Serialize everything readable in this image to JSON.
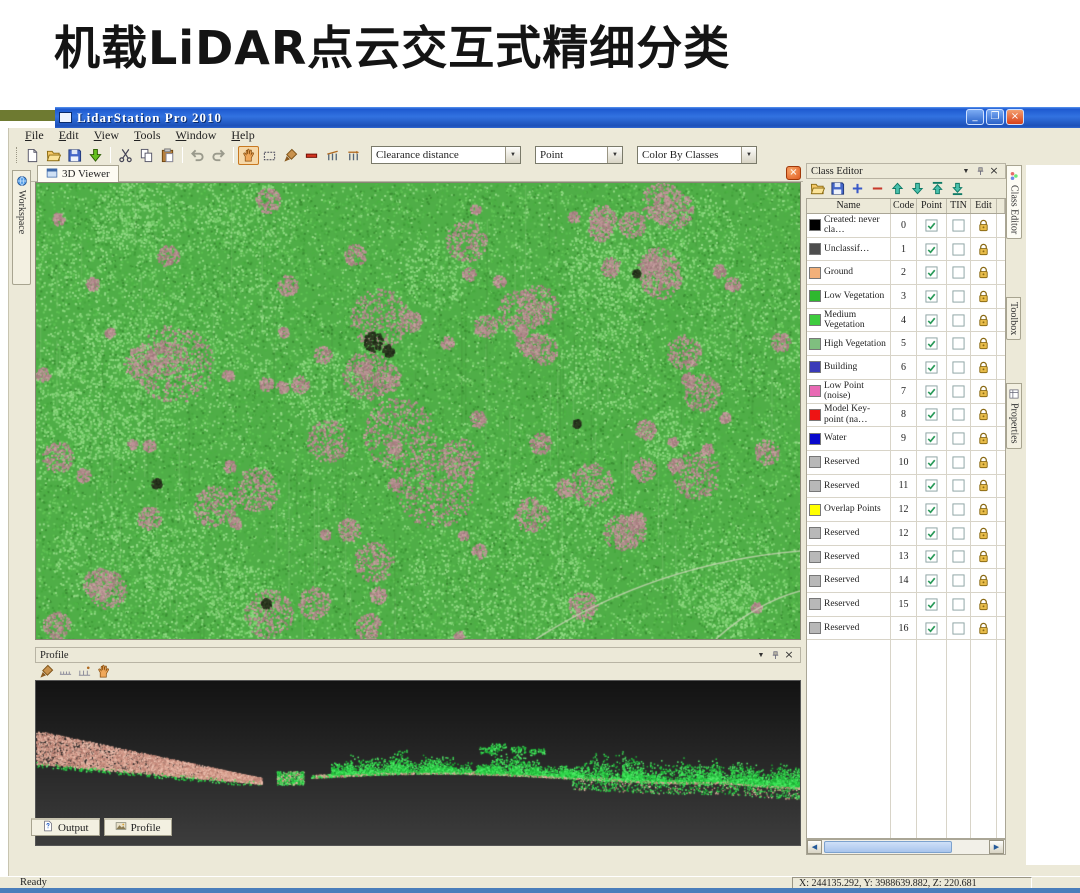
{
  "slide": {
    "title": "机载LiDAR点云交互式精细分类"
  },
  "app": {
    "title": "LidarStation Pro 2010",
    "window_buttons": {
      "minimize": "_",
      "restore": "❐",
      "close": "×"
    },
    "menus": [
      "File",
      "Edit",
      "View",
      "Tools",
      "Window",
      "Help"
    ],
    "toolbar": {
      "icon_groups": [
        [
          "new-document",
          "open",
          "save",
          "import"
        ],
        [
          "cut",
          "copy",
          "paste"
        ],
        [
          "undo",
          "redo"
        ],
        [
          "pan-hand",
          "rect-select",
          "brush",
          "profile-line",
          "section-a",
          "section-b"
        ]
      ],
      "dropdowns": [
        {
          "name": "clearance-distance",
          "value": "Clearance distance"
        },
        {
          "name": "point-mode",
          "value": "Point"
        },
        {
          "name": "color-by",
          "value": "Color By Classes"
        }
      ]
    },
    "workspace_tab": "Workspace",
    "viewer_tab": "3D Viewer",
    "class_editor": {
      "title": "Class Editor",
      "toolbar_icons": [
        "folder",
        "save",
        "add",
        "remove",
        "move-up",
        "move-down",
        "move-top",
        "move-bottom"
      ],
      "columns": [
        "Name",
        "Code",
        "Point",
        "TIN",
        "Edit"
      ],
      "rows": [
        {
          "name": "Created: never cla…",
          "code": "0",
          "color": "#000000",
          "point": true,
          "tin": false,
          "locked": true
        },
        {
          "name": "Unclassif…",
          "code": "1",
          "color": "#4d4d4d",
          "point": true,
          "tin": false,
          "locked": true
        },
        {
          "name": "Ground",
          "code": "2",
          "color": "#f2b079",
          "point": true,
          "tin": false,
          "locked": true
        },
        {
          "name": "Low Vegetation",
          "code": "3",
          "color": "#2eb82e",
          "point": true,
          "tin": false,
          "locked": true
        },
        {
          "name": "Medium Vegetation",
          "code": "4",
          "color": "#3ecc3e",
          "point": true,
          "tin": false,
          "locked": true
        },
        {
          "name": "High Vegetation",
          "code": "5",
          "color": "#7fbf7f",
          "point": true,
          "tin": false,
          "locked": true
        },
        {
          "name": "Building",
          "code": "6",
          "color": "#3a3ab8",
          "point": true,
          "tin": false,
          "locked": true
        },
        {
          "name": "Low Point (noise)",
          "code": "7",
          "color": "#e869b4",
          "point": true,
          "tin": false,
          "locked": true
        },
        {
          "name": "Model Key-point (na…",
          "code": "8",
          "color": "#ee1414",
          "point": true,
          "tin": false,
          "locked": true
        },
        {
          "name": "Water",
          "code": "9",
          "color": "#0808cc",
          "point": true,
          "tin": false,
          "locked": true
        },
        {
          "name": "Reserved",
          "code": "10",
          "color": "#b8b8b8",
          "point": true,
          "tin": false,
          "locked": true
        },
        {
          "name": "Reserved",
          "code": "11",
          "color": "#b8b8b8",
          "point": true,
          "tin": false,
          "locked": true
        },
        {
          "name": "Overlap Points",
          "code": "12",
          "color": "#ffff00",
          "point": true,
          "tin": false,
          "locked": true
        },
        {
          "name": "Reserved",
          "code": "12",
          "color": "#b8b8b8",
          "point": true,
          "tin": false,
          "locked": true
        },
        {
          "name": "Reserved",
          "code": "13",
          "color": "#b8b8b8",
          "point": true,
          "tin": false,
          "locked": true
        },
        {
          "name": "Reserved",
          "code": "14",
          "color": "#b8b8b8",
          "point": true,
          "tin": false,
          "locked": true
        },
        {
          "name": "Reserved",
          "code": "15",
          "color": "#b8b8b8",
          "point": true,
          "tin": false,
          "locked": true
        },
        {
          "name": "Reserved",
          "code": "16",
          "color": "#b8b8b8",
          "point": true,
          "tin": false,
          "locked": true
        }
      ]
    },
    "right_tabs": [
      {
        "label": "Class Editor",
        "icon": "classes",
        "active": true
      },
      {
        "label": "Toolbox",
        "icon": "",
        "active": false
      },
      {
        "label": "Properties",
        "icon": "properties",
        "active": false
      }
    ],
    "profile_panel": {
      "title": "Profile",
      "toolbar_icons": [
        "brush",
        "measure-a",
        "measure-b",
        "pan-hand"
      ]
    },
    "bottom_tabs": [
      {
        "label": "Output",
        "icon": "output"
      },
      {
        "label": "Profile",
        "icon": "profile-pic"
      }
    ],
    "status": {
      "ready": "Ready",
      "coords": "X: 244135.292, Y: 3988639.882, Z: 220.681"
    }
  },
  "colors": {
    "titlebar_blue": "#2f66d0",
    "olive_accent": "#6e7a31",
    "bottom_bar_blue": "#4a7ebb",
    "viewer_base_green": "#4fae47",
    "viewer_pink_patch": "#b18b8d",
    "profile_ground_pink": "#d9a08e",
    "profile_vegetation_green": "#2ed84a"
  }
}
